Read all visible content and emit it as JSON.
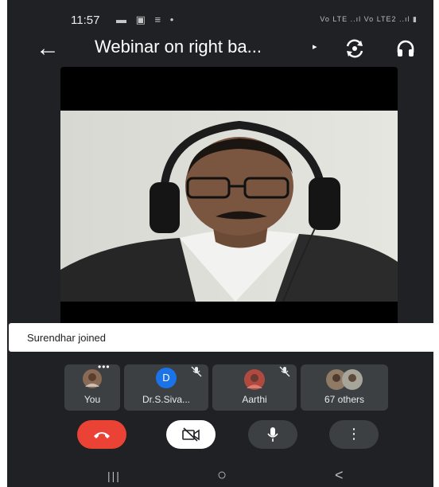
{
  "status_bar": {
    "time": "11:57",
    "icons": [
      "message-icon",
      "gallery-icon",
      "notification-icon",
      "dot-icon"
    ],
    "icon_glyphs": "▬ ▣ ≡ •",
    "right": "Vo LTE ..ıl Vo LTE2 ..ıl ▮",
    "colors": {
      "text": "#e8eaed"
    }
  },
  "app_bar": {
    "back_icon": "←",
    "title": "Webinar on right ba...",
    "title_arrow": "▸",
    "switch_camera_icon": "switch-camera-icon",
    "audio_icon": "headphones-icon"
  },
  "video": {
    "subject": "main-speaker-video"
  },
  "toast": {
    "text": "Surendhar joined"
  },
  "participants": [
    {
      "label": "You",
      "avatar": "photo",
      "more": "•••"
    },
    {
      "label": "Dr.S.Siva...",
      "avatar": "D",
      "avatar_color": "#1a73e8",
      "muted": true
    },
    {
      "label": "Aarthi",
      "avatar": "photo",
      "muted": true
    },
    {
      "label": "67 others",
      "avatar": "group-photo"
    }
  ],
  "controls": {
    "end_call_color": "#ea4335",
    "camera_bg": "#ffffff",
    "mic_bg": "#3c4043",
    "more_bg": "#3c4043",
    "more_glyph": "⋮"
  },
  "nav": {
    "recent": "|||",
    "home": "○",
    "back": "<"
  }
}
